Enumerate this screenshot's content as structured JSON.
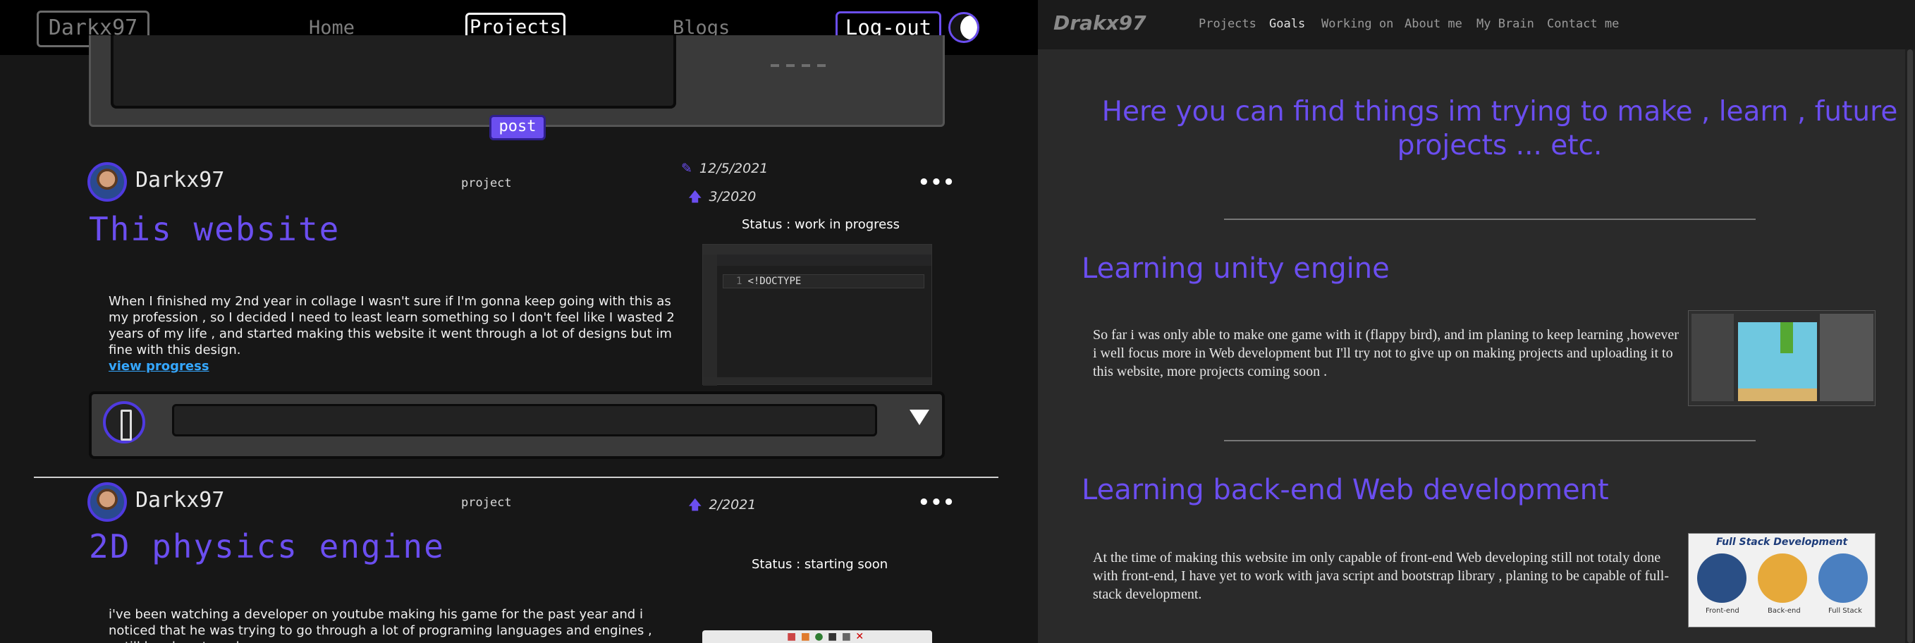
{
  "left": {
    "nav": {
      "logo": "Darkx97",
      "home": "Home",
      "projects": "Projects",
      "blogs": "Blogs",
      "logout": "Log-out"
    },
    "post_button": "post",
    "posts": [
      {
        "username": "Darkx97",
        "tag": "project",
        "edit_date": "12/5/2021",
        "date": "3/2020",
        "more": "•••",
        "title": "This website",
        "status": "Status : work in progress",
        "body": "When I finished my 2nd year in collage I wasn't sure if I'm gonna keep going with this as my profession , so I decided I need to least learn something so I don't feel like I wasted 2 years of my life , and started making this website it went through a lot of designs but im fine with this design.",
        "link": "view progress",
        "code_line_number": "1",
        "code_text": "<!DOCTYPE"
      },
      {
        "username": "Darkx97",
        "tag": "project",
        "date": "2/2021",
        "more": "•••",
        "title": "2D physics engine",
        "status": "Status : starting soon",
        "body": "i've been watching a developer on youtube making his game for the past year and i noticed that he was trying to go through a lot of programing languages and engines , untill he alsmot made"
      }
    ]
  },
  "right": {
    "brand": "Drakx97",
    "nav": [
      "Projects",
      "Goals",
      "Working on",
      "About me",
      "My Brain",
      "Contact me"
    ],
    "active_nav": "Goals",
    "heading": "Here you can find things im trying to make , learn , future projects ... etc.",
    "sections": [
      {
        "title": "Learning unity engine",
        "text": "So far i was only able to make one game with it (flappy bird), and im planing to keep learning ,however i well focus more in Web development but I'll try not to give up on making projects and uploading it to this website, more projects coming soon ."
      },
      {
        "title": "Learning back-end Web development",
        "text": "At the time of making this website im only capable of front-end Web developing still not totaly done with front-end, I have yet to work with java script and bootstrap library , planing to be capable of full-stack development.",
        "image": {
          "title": "Full Stack Development",
          "labels": [
            "Front-end",
            "Back-end",
            "Full Stack"
          ]
        }
      }
    ]
  },
  "colors": {
    "accent": "#6b4ef0",
    "link": "#35a7ff",
    "left_bg": "#171717",
    "right_bg": "#2a2a2a"
  },
  "icons": [
    "moon-icon",
    "pencil-icon",
    "upvote-arrow-icon",
    "more-icon",
    "send-arrow-icon"
  ]
}
